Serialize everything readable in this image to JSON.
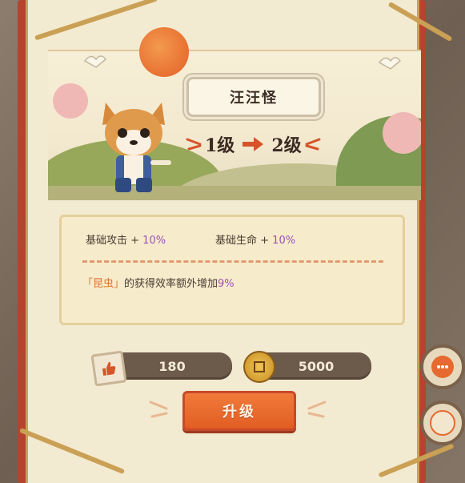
{
  "title": "汪汪怪",
  "level": {
    "from": "1级",
    "to": "2级"
  },
  "stats": [
    {
      "name": "基础攻击 + ",
      "value": "10%"
    },
    {
      "name": "基础生命 + ",
      "value": "10%"
    }
  ],
  "bonus": {
    "tag": "「昆虫」",
    "text": "的获得效率额外增加",
    "value": "9%"
  },
  "cost": {
    "likes": "180",
    "coins": "5000"
  },
  "upgrade_label": "升级",
  "icons": [
    "thumbs-up-icon",
    "coin-icon",
    "chat-icon",
    "gift-icon",
    "arrow-icon"
  ],
  "colors": {
    "accent": "#e25d23",
    "purple": "#9b4fb4",
    "frame": "#b6432d"
  }
}
